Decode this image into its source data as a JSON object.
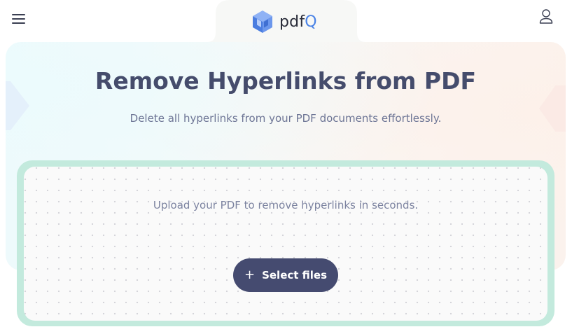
{
  "header": {
    "menu_icon": "hamburger-menu-icon",
    "logo": {
      "icon": "cube-logo-icon",
      "text_main": "pdf",
      "text_accent": "Q",
      "accent_color": "#4a83e6"
    },
    "user_icon": "user-profile-icon"
  },
  "hero": {
    "title": "Remove Hyperlinks from PDF",
    "subtitle": "Delete all hyperlinks from your PDF documents effortlessly."
  },
  "upload": {
    "instruction": "Upload your PDF to remove hyperlinks in seconds.",
    "button_icon": "+",
    "button_label": "Select files",
    "button_color": "#454b70",
    "border_color": "#c3eadd"
  }
}
